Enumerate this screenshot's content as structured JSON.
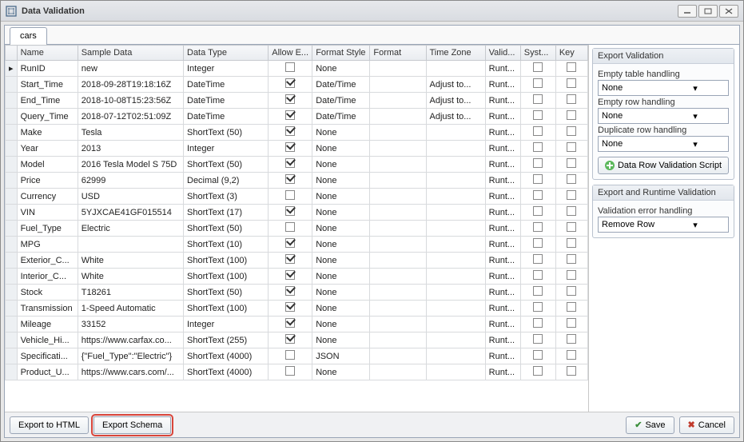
{
  "window": {
    "title": "Data Validation"
  },
  "tabs": [
    {
      "label": "cars"
    }
  ],
  "columns": {
    "rowhdr": "",
    "name": "Name",
    "sample": "Sample Data",
    "dtype": "Data Type",
    "allow": "Allow E...",
    "fstyle": "Format Style",
    "format": "Format",
    "tz": "Time Zone",
    "valid": "Valid...",
    "syst": "Syst...",
    "key": "Key"
  },
  "rows": [
    {
      "name": "RunID",
      "sample": "new",
      "dtype": "Integer",
      "allow": false,
      "fstyle": "None",
      "format": "",
      "tz": "",
      "valid": "Runt...",
      "syst": false,
      "key": false,
      "isCurrent": true
    },
    {
      "name": "Start_Time",
      "sample": "2018-09-28T19:18:16Z",
      "dtype": "DateTime",
      "allow": true,
      "fstyle": "Date/Time",
      "format": "",
      "tz": "Adjust to...",
      "valid": "Runt...",
      "syst": false,
      "key": false
    },
    {
      "name": "End_Time",
      "sample": "2018-10-08T15:23:56Z",
      "dtype": "DateTime",
      "allow": true,
      "fstyle": "Date/Time",
      "format": "",
      "tz": "Adjust to...",
      "valid": "Runt...",
      "syst": false,
      "key": false
    },
    {
      "name": "Query_Time",
      "sample": "2018-07-12T02:51:09Z",
      "dtype": "DateTime",
      "allow": true,
      "fstyle": "Date/Time",
      "format": "",
      "tz": "Adjust to...",
      "valid": "Runt...",
      "syst": false,
      "key": false
    },
    {
      "name": "Make",
      "sample": "Tesla",
      "dtype": "ShortText (50)",
      "allow": true,
      "fstyle": "None",
      "format": "",
      "tz": "",
      "valid": "Runt...",
      "syst": false,
      "key": false
    },
    {
      "name": "Year",
      "sample": "2013",
      "dtype": "Integer",
      "allow": true,
      "fstyle": "None",
      "format": "",
      "tz": "",
      "valid": "Runt...",
      "syst": false,
      "key": false
    },
    {
      "name": "Model",
      "sample": "2016 Tesla Model S 75D",
      "dtype": "ShortText (50)",
      "allow": true,
      "fstyle": "None",
      "format": "",
      "tz": "",
      "valid": "Runt...",
      "syst": false,
      "key": false
    },
    {
      "name": "Price",
      "sample": "62999",
      "dtype": "Decimal (9,2)",
      "allow": true,
      "fstyle": "None",
      "format": "",
      "tz": "",
      "valid": "Runt...",
      "syst": false,
      "key": false
    },
    {
      "name": "Currency",
      "sample": "USD",
      "dtype": "ShortText (3)",
      "allow": false,
      "fstyle": "None",
      "format": "",
      "tz": "",
      "valid": "Runt...",
      "syst": false,
      "key": false
    },
    {
      "name": "VIN",
      "sample": "5YJXCAE41GF015514",
      "dtype": "ShortText (17)",
      "allow": true,
      "fstyle": "None",
      "format": "",
      "tz": "",
      "valid": "Runt...",
      "syst": false,
      "key": false
    },
    {
      "name": "Fuel_Type",
      "sample": "Electric",
      "dtype": "ShortText (50)",
      "allow": false,
      "fstyle": "None",
      "format": "",
      "tz": "",
      "valid": "Runt...",
      "syst": false,
      "key": false
    },
    {
      "name": "MPG",
      "sample": "",
      "dtype": "ShortText (10)",
      "allow": true,
      "fstyle": "None",
      "format": "",
      "tz": "",
      "valid": "Runt...",
      "syst": false,
      "key": false
    },
    {
      "name": "Exterior_C...",
      "sample": "White",
      "dtype": "ShortText (100)",
      "allow": true,
      "fstyle": "None",
      "format": "",
      "tz": "",
      "valid": "Runt...",
      "syst": false,
      "key": false
    },
    {
      "name": "Interior_C...",
      "sample": "White",
      "dtype": "ShortText (100)",
      "allow": true,
      "fstyle": "None",
      "format": "",
      "tz": "",
      "valid": "Runt...",
      "syst": false,
      "key": false
    },
    {
      "name": "Stock",
      "sample": "T18261",
      "dtype": "ShortText (50)",
      "allow": true,
      "fstyle": "None",
      "format": "",
      "tz": "",
      "valid": "Runt...",
      "syst": false,
      "key": false
    },
    {
      "name": "Transmission",
      "sample": "1-Speed Automatic",
      "dtype": "ShortText (100)",
      "allow": true,
      "fstyle": "None",
      "format": "",
      "tz": "",
      "valid": "Runt...",
      "syst": false,
      "key": false
    },
    {
      "name": "Mileage",
      "sample": "33152",
      "dtype": "Integer",
      "allow": true,
      "fstyle": "None",
      "format": "",
      "tz": "",
      "valid": "Runt...",
      "syst": false,
      "key": false
    },
    {
      "name": "Vehicle_Hi...",
      "sample": "https://www.carfax.co...",
      "dtype": "ShortText (255)",
      "allow": true,
      "fstyle": "None",
      "format": "",
      "tz": "",
      "valid": "Runt...",
      "syst": false,
      "key": false
    },
    {
      "name": "Specificati...",
      "sample": "{\"Fuel_Type\":\"Electric\"}",
      "dtype": "ShortText (4000)",
      "allow": false,
      "fstyle": "JSON",
      "format": "",
      "tz": "",
      "valid": "Runt...",
      "syst": false,
      "key": false
    },
    {
      "name": "Product_U...",
      "sample": "https://www.cars.com/...",
      "dtype": "ShortText (4000)",
      "allow": false,
      "fstyle": "None",
      "format": "",
      "tz": "",
      "valid": "Runt...",
      "syst": false,
      "key": false
    }
  ],
  "side": {
    "group1": {
      "title": "Export Validation",
      "emptyTableLabel": "Empty table handling",
      "emptyTableValue": "None",
      "emptyRowLabel": "Empty row handling",
      "emptyRowValue": "None",
      "dupLabel": "Duplicate row handling",
      "dupValue": "None",
      "scriptBtn": "Data Row Validation Script"
    },
    "group2": {
      "title": "Export and Runtime Validation",
      "errLabel": "Validation error handling",
      "errValue": "Remove Row"
    }
  },
  "footer": {
    "exportHtml": "Export to HTML",
    "exportSchema": "Export Schema",
    "save": "Save",
    "cancel": "Cancel"
  }
}
